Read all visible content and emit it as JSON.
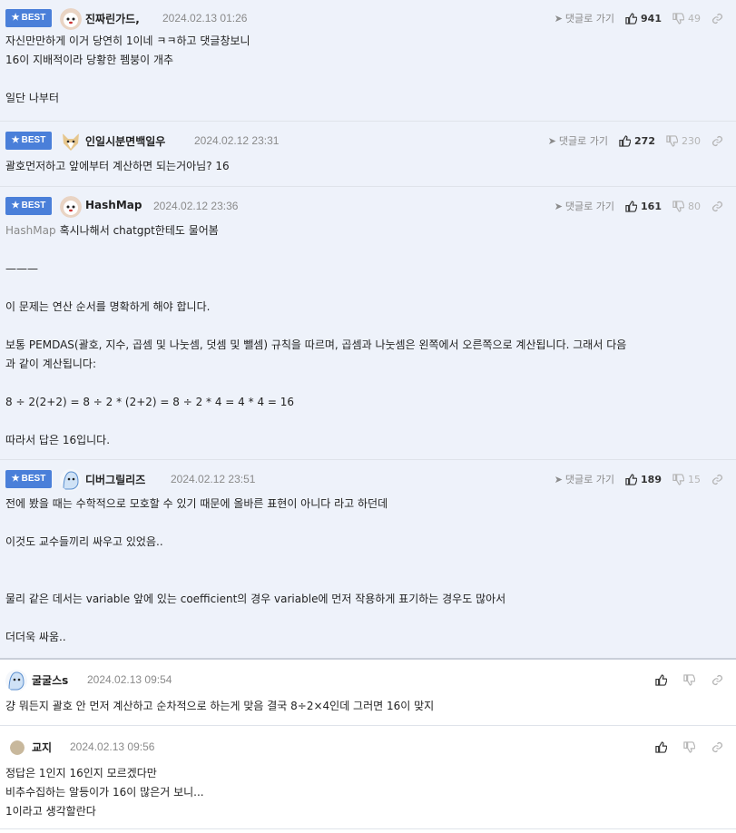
{
  "ui": {
    "badge": "BEST",
    "goto": "댓글로 가기"
  },
  "comments": [
    {
      "nick": "진짜린가드,",
      "date": "2024.02.13 01:26",
      "up": "941",
      "down": "49",
      "lines": [
        "자신만만하게 이거 당연히 1이네 ㅋㅋ하고 댓글창보니",
        "16이 지배적이라 당황한 펨붕이 개추",
        "",
        "일단 나부터"
      ]
    },
    {
      "nick": "인일시분면백일우",
      "date": "2024.02.12 23:31",
      "up": "272",
      "down": "230",
      "lines": [
        "괄호먼저하고 앞에부터 계산하면 되는거아님? 16"
      ]
    },
    {
      "nick": "HashMap",
      "date": "2024.02.12 23:36",
      "up": "161",
      "down": "80",
      "quote": "HashMap",
      "lines": [
        "혹시나해서 chatgpt한테도 물어봄",
        "",
        "———",
        "",
        "이 문제는 연산 순서를 명확하게 해야 합니다.",
        "",
        "보통 PEMDAS(괄호, 지수, 곱셈 및 나눗셈, 덧셈 및 뺄셈) 규칙을 따르며, 곱셈과 나눗셈은 왼쪽에서 오른쪽으로 계산됩니다. 그래서 다음",
        "과 같이 계산됩니다:",
        "",
        "8 ÷ 2(2+2) = 8 ÷ 2 * (2+2) = 8 ÷ 2 * 4 = 4 * 4 = 16",
        "",
        "따라서 답은 16입니다."
      ]
    },
    {
      "nick": "디버그릴리즈",
      "date": "2024.02.12 23:51",
      "up": "189",
      "down": "15",
      "lines": [
        "전에 봤을 때는 수학적으로 모호할 수 있기 때문에 올바른 표현이 아니다 라고 하던데",
        "",
        "이것도 교수들끼리 싸우고 있었음..",
        "",
        "",
        "물리 같은 데서는 variable 앞에 있는 coefficient의 경우 variable에 먼저 작용하게 표기하는 경우도 많아서",
        "",
        "더더욱 싸움.."
      ]
    },
    {
      "nick": "굴굴스s",
      "date": "2024.02.13 09:54",
      "lines": [
        "걍 뭐든지 괄호 안 먼저 계산하고 순차적으로 하는게 맞음 결국 8÷2×4인데 그러면 16이 맞지"
      ]
    },
    {
      "nick": "교지",
      "date": "2024.02.13 09:56",
      "lines": [
        "정답은 1인지 16인지 모르겠다만",
        "비추수집하는 알등이가 16이 많은거 보니...",
        "1이라고 생각할란다"
      ]
    }
  ]
}
